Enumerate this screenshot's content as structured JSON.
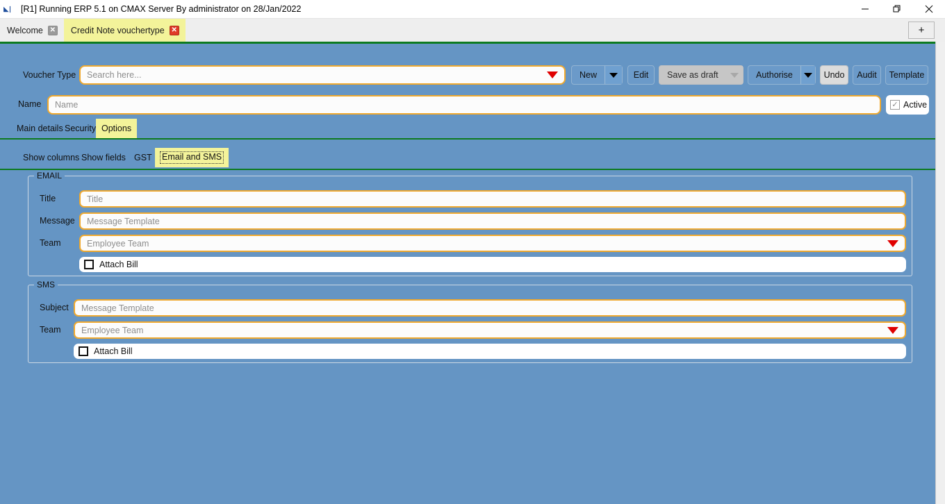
{
  "window": {
    "title": "[R1] Running ERP 5.1 on CMAX Server By administrator on 28/Jan/2022",
    "app_icon": "erp-icon",
    "controls": {
      "minimize": "minimize-icon",
      "restore": "restore-icon",
      "close": "close-icon"
    }
  },
  "tabstrip": {
    "tabs": [
      {
        "label": "Welcome",
        "active": false,
        "close": "✕"
      },
      {
        "label": "Credit Note vouchertype",
        "active": true,
        "close": "✕"
      }
    ],
    "new_tab_label": "+"
  },
  "toolbar": {
    "voucher_type_label": "Voucher Type",
    "search_placeholder": "Search here...",
    "buttons": [
      {
        "label": "New",
        "split": true,
        "disabled": false
      },
      {
        "label": "Edit",
        "split": false,
        "disabled": false
      },
      {
        "label": "Save as draft",
        "split": true,
        "disabled": true
      },
      {
        "label": "Authorise",
        "split": true,
        "disabled": false
      },
      {
        "label": "Undo",
        "split": false,
        "disabled": false
      },
      {
        "label": "Audit",
        "split": false,
        "disabled": false
      },
      {
        "label": "Template",
        "split": false,
        "disabled": false
      }
    ]
  },
  "name_row": {
    "label": "Name",
    "placeholder": "Name",
    "value": "",
    "active_label": "Active",
    "active_checked": true,
    "check_glyph": "✓"
  },
  "tabs_primary": [
    {
      "label": "Main details",
      "selected": false
    },
    {
      "label": "Security",
      "selected": false
    },
    {
      "label": "Options",
      "selected": true
    }
  ],
  "tabs_secondary": [
    {
      "label": "Show columns",
      "selected": false
    },
    {
      "label": "Show fields",
      "selected": false
    },
    {
      "label": "GST",
      "selected": false
    },
    {
      "label": "Email and SMS",
      "selected": true
    }
  ],
  "email_group": {
    "legend": "EMAIL",
    "title_label": "Title",
    "title_placeholder": "Title",
    "message_label": "Message",
    "message_placeholder": "Message Template",
    "team_label": "Team",
    "team_placeholder": "Employee Team",
    "attach_label": "Attach Bill",
    "attach_checked": false
  },
  "sms_group": {
    "legend": "SMS",
    "subject_label": "Subject",
    "subject_placeholder": "Message Template",
    "team_label": "Team",
    "team_placeholder": "Employee Team",
    "attach_label": "Attach Bill",
    "attach_checked": false
  },
  "colors": {
    "workarea_bg": "#6595c4",
    "accent_green": "#0d7a1f",
    "tab_active": "#f3f39a",
    "field_border": "#f0a92e",
    "caret_red": "#e00000",
    "button_blue": "#6b9ac9"
  }
}
